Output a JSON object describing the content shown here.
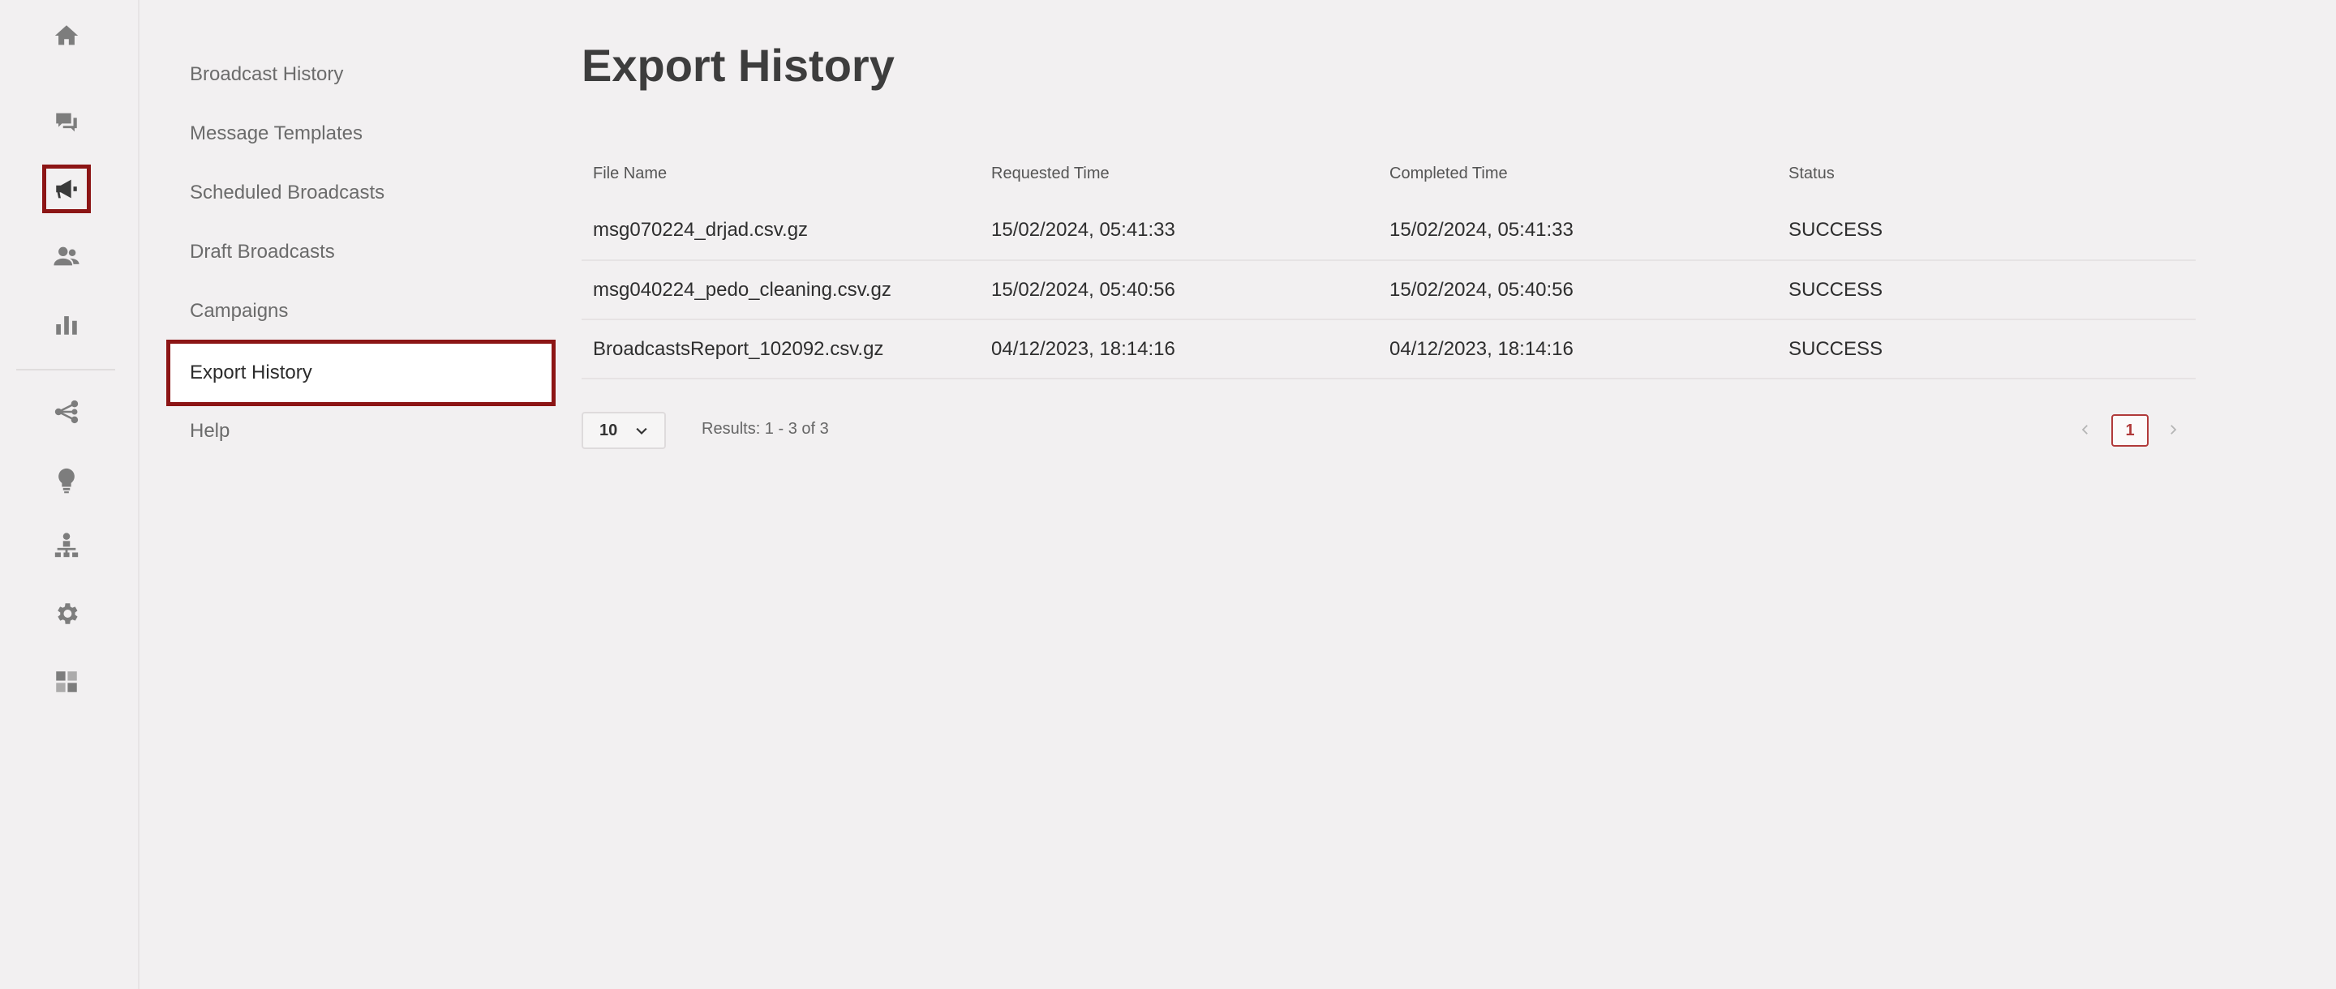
{
  "rail": {
    "icons": [
      "home-icon",
      "chat-icon",
      "megaphone-icon",
      "users-icon",
      "bar-chart-icon",
      "flow-icon",
      "lightbulb-icon",
      "hierarchy-icon",
      "gear-icon",
      "integrations-icon"
    ],
    "active": "megaphone-icon"
  },
  "submenu": {
    "items": [
      {
        "label": "Broadcast History"
      },
      {
        "label": "Message Templates"
      },
      {
        "label": "Scheduled Broadcasts"
      },
      {
        "label": "Draft Broadcasts"
      },
      {
        "label": "Campaigns"
      },
      {
        "label": "Export History"
      },
      {
        "label": "Help"
      }
    ],
    "active": "Export History"
  },
  "page": {
    "title": "Export History"
  },
  "table": {
    "headers": [
      "File Name",
      "Requested Time",
      "Completed Time",
      "Status"
    ],
    "rows": [
      [
        "msg070224_drjad.csv.gz",
        "15/02/2024, 05:41:33",
        "15/02/2024, 05:41:33",
        "SUCCESS"
      ],
      [
        "msg040224_pedo_cleaning.csv.gz",
        "15/02/2024, 05:40:56",
        "15/02/2024, 05:40:56",
        "SUCCESS"
      ],
      [
        "BroadcastsReport_102092.csv.gz",
        "04/12/2023, 18:14:16",
        "04/12/2023, 18:14:16",
        "SUCCESS"
      ]
    ]
  },
  "pagination": {
    "page_size": "10",
    "results_text": "Results: 1 - 3 of 3",
    "current_page": "1"
  },
  "colors": {
    "accent": "#8c1515",
    "pager_accent": "#b03a3a",
    "background": "#f2f0f1"
  }
}
